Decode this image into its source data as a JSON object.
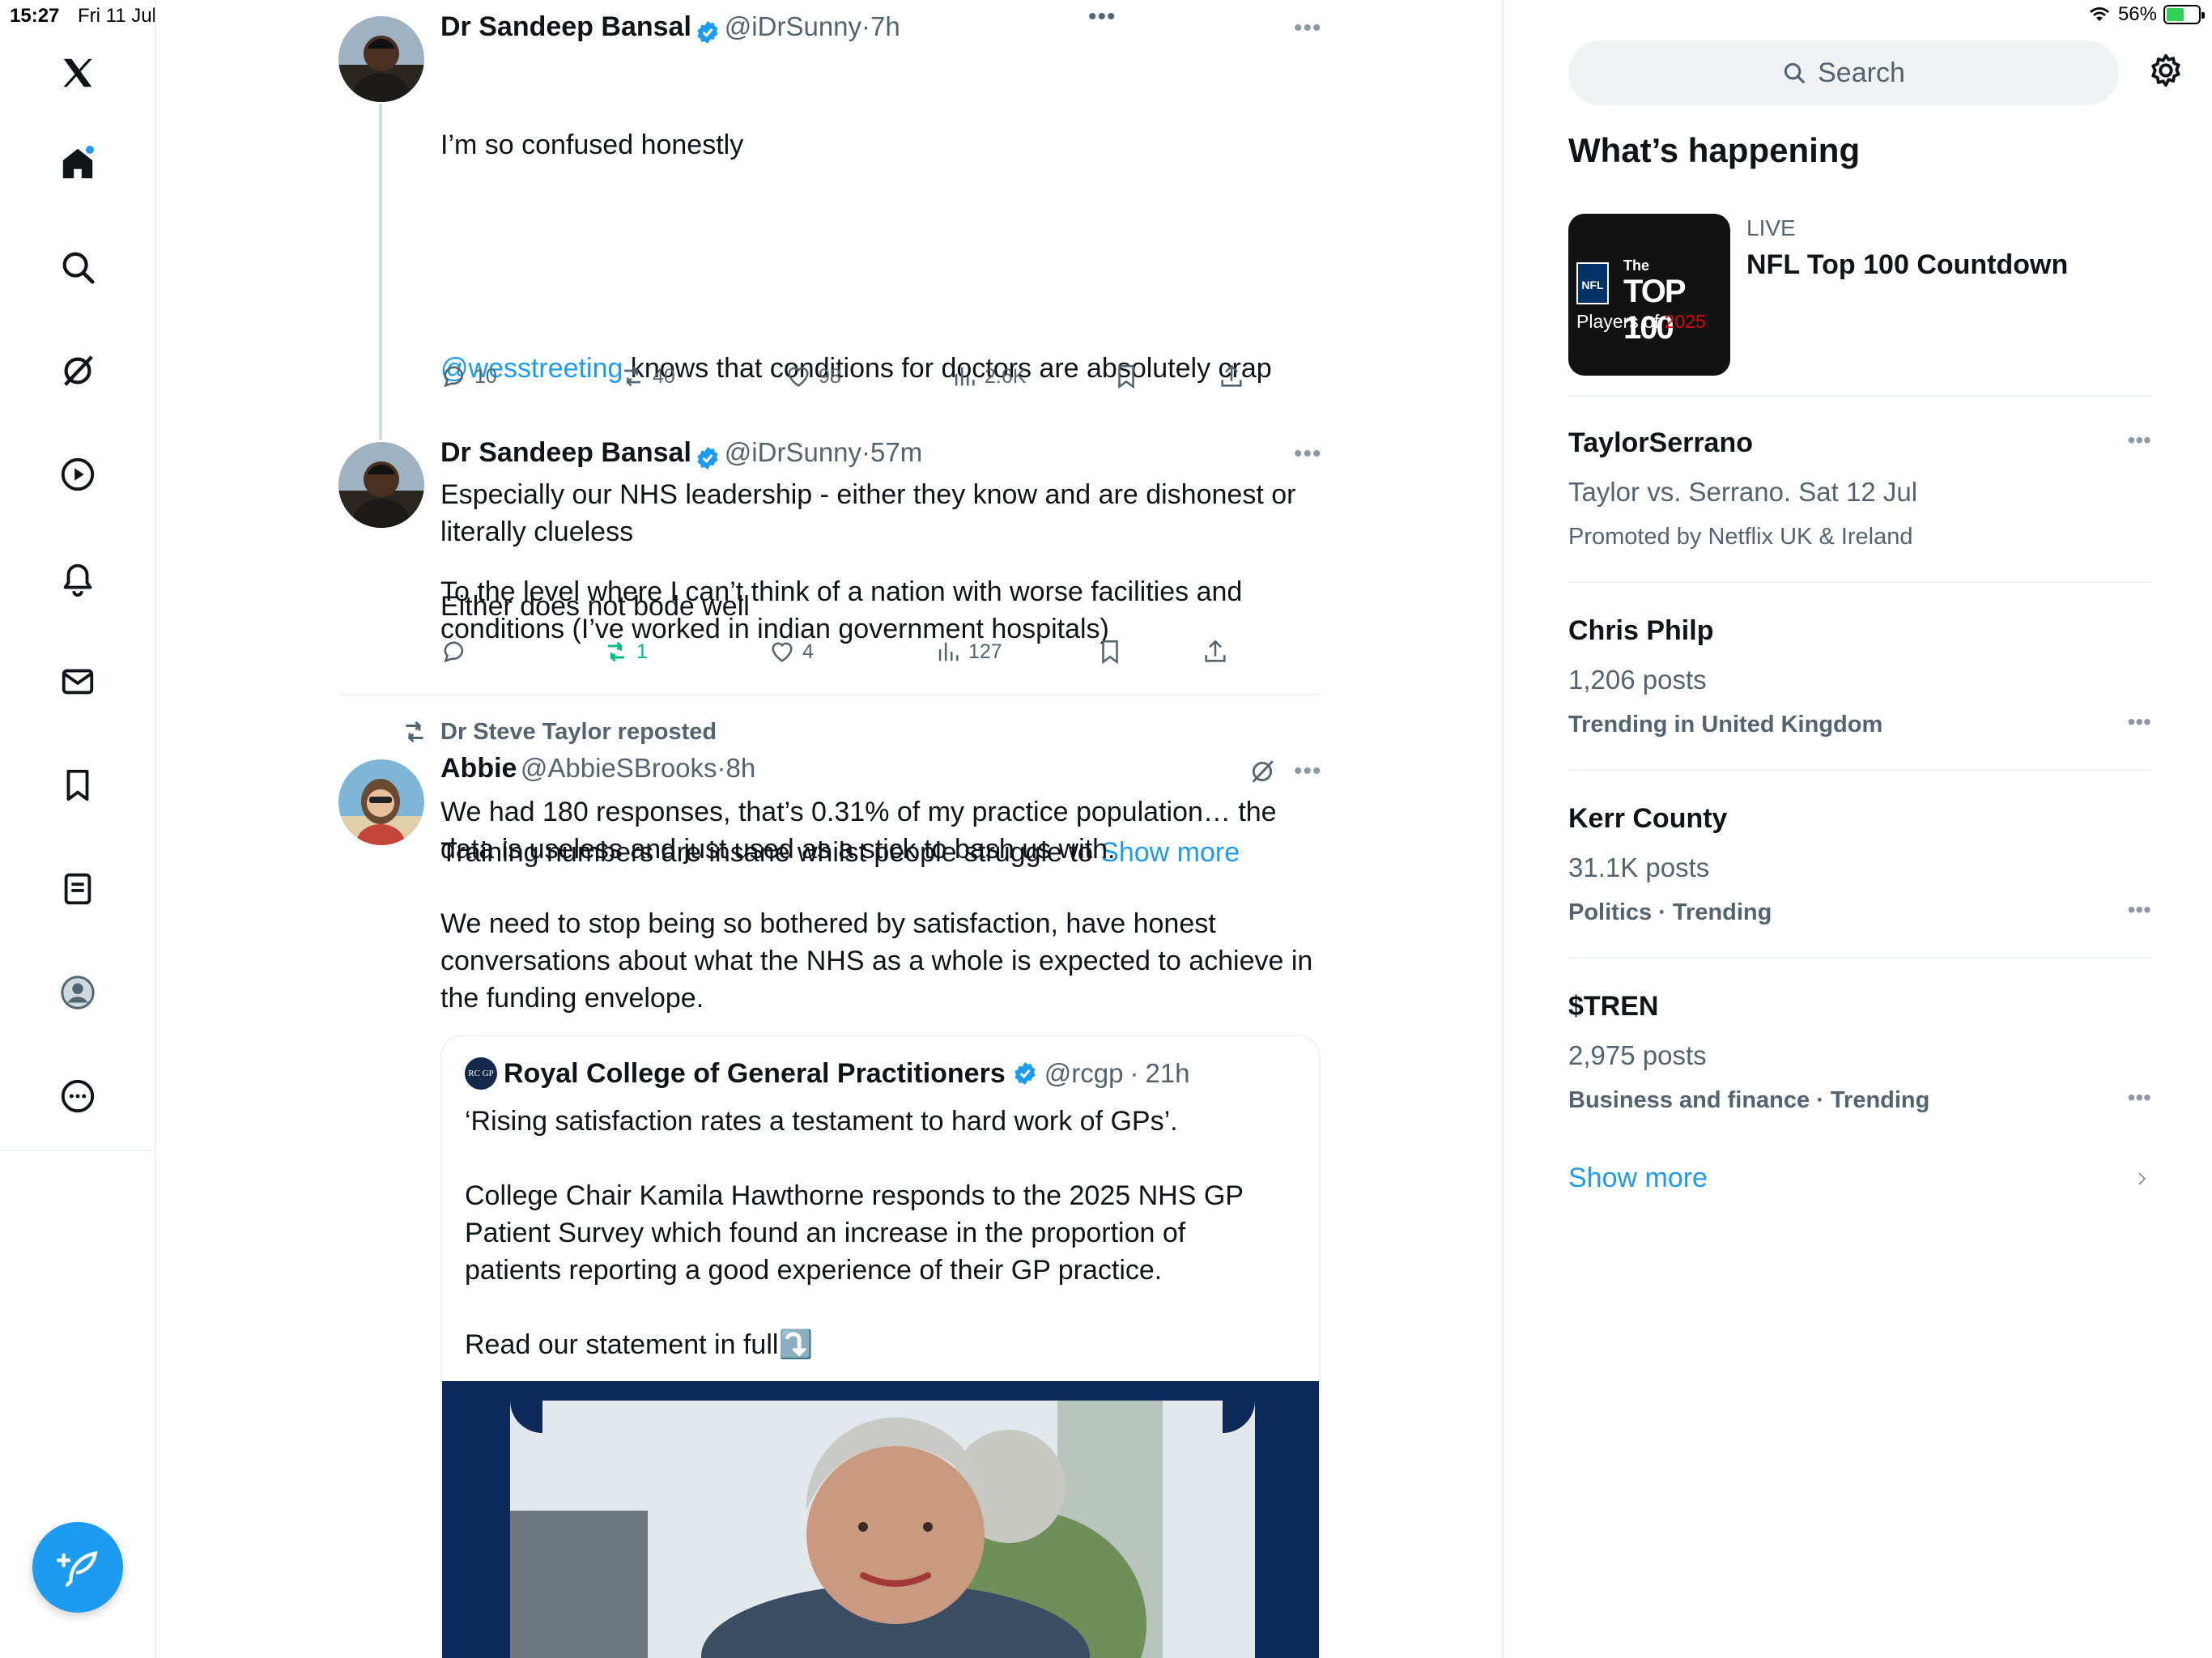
{
  "status_bar": {
    "time": "15:27",
    "date": "Fri 11 Jul",
    "battery": "56%",
    "battery_level": 0.56
  },
  "nav": {
    "icons": [
      "x-logo-icon",
      "home-icon",
      "search-icon",
      "grok-icon",
      "video-icon",
      "bell-icon",
      "mail-icon",
      "bookmark-icon",
      "list-icon",
      "profile-icon",
      "more-icon"
    ]
  },
  "top_more": "•••",
  "post1": {
    "name": "Dr Sandeep Bansal",
    "handle": "@iDrSunny",
    "sep": "·",
    "time": "7h",
    "line1": "I’m so confused honestly",
    "mention": "@wesstreeting",
    "line2_rest": " knows that conditions for doctors are absolutely crap",
    "line3": "To the level where I can’t think of a nation with worse facilities and\nconditions (I’ve worked in indian government hospitals)",
    "line4": "Training numbers are insane whilst people struggle to ",
    "show_more": "Show more",
    "replies": "10",
    "reposts": "40",
    "likes": "98",
    "views": "2.6K"
  },
  "post2": {
    "name": "Dr Sandeep Bansal",
    "handle": "@iDrSunny",
    "sep": "·",
    "time": "57m",
    "text": "Especially our NHS leadership - either they know and are dishonest or\nliterally clueless\n\nEither does not bode well",
    "replies": "",
    "reposts": "1",
    "likes": "4",
    "views": "127"
  },
  "post3": {
    "repost_label": "Dr Steve Taylor reposted",
    "name": "Abbie",
    "handle": "@AbbieSBrooks",
    "sep": "·",
    "time": "8h",
    "text": "We had 180 responses, that’s 0.31% of my practice population… the\ndata is useless and just used as a stick to bash us with.\n\nWe need to stop being so bothered by satisfaction, have honest\nconversations about what the NHS as a whole is expected to achieve in\nthe funding envelope."
  },
  "quote": {
    "logo_text": "RC GP",
    "name": "Royal College of General Practitioners",
    "handle": "@rcgp",
    "sep": "·",
    "time": "21h",
    "text": "‘Rising satisfaction rates a testament to hard work of GPs’.\n\nCollege Chair Kamila Hawthorne responds to the 2025 NHS GP\nPatient Survey which found an increase in the proportion of\npatients reporting a good experience of their GP practice.\n\nRead our statement in full",
    "emoji": "⤵️"
  },
  "sidebar": {
    "search_placeholder": "Search",
    "title": "What’s happening",
    "live": {
      "badge": "LIVE",
      "title": "NFL Top 100 Countdown",
      "img_the": "The",
      "img_top": "TOP 100",
      "img_players": "Players of ",
      "img_year": "2025",
      "img_nfl": "NFL"
    },
    "trends": [
      {
        "head": "TaylorSerrano",
        "sub": "Taylor vs. Serrano. Sat 12 Jul",
        "meta": "Promoted by Netflix UK & Ireland"
      },
      {
        "head": "Chris Philp",
        "sub": "1,206 posts",
        "meta": "Trending in United Kingdom"
      },
      {
        "head": "Kerr County",
        "sub": "31.1K posts",
        "meta": "Politics · Trending"
      },
      {
        "head": "$TREN",
        "sub": "2,975 posts",
        "meta": "Business and finance · Trending"
      }
    ],
    "show_more": "Show more",
    "dots": "•••"
  },
  "colors": {
    "accent": "#1d9bf0",
    "repost_green": "#00ba7c",
    "text": "#0f1419",
    "muted": "#536471"
  }
}
